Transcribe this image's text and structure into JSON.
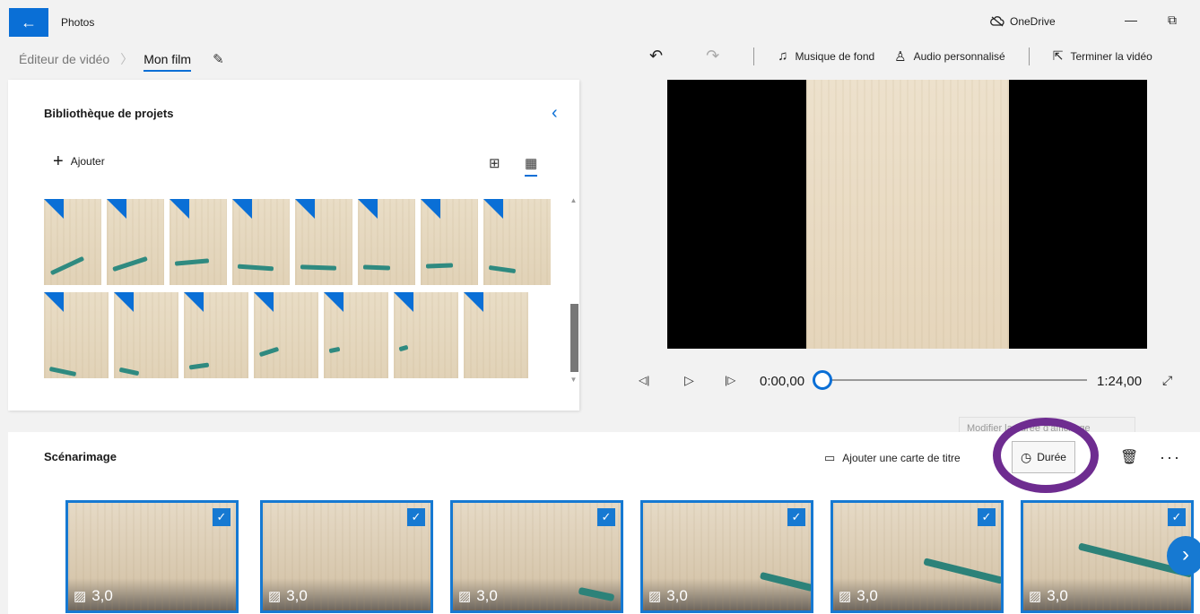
{
  "window": {
    "app_title": "Photos",
    "onedrive_label": "OneDrive",
    "minimize_glyph": "—",
    "restore_glyph": "⧉"
  },
  "breadcrumb": {
    "parent": "Éditeur de vidéo",
    "current": "Mon film"
  },
  "toolbar": {
    "undo_icon": "undo-icon",
    "redo_icon": "redo-icon",
    "background_music": "Musique de fond",
    "custom_audio": "Audio personnalisé",
    "finish_video": "Terminer la vidéo"
  },
  "library": {
    "title": "Bibliothèque de projets",
    "add_label": "Ajouter",
    "thumbnails_count": 15
  },
  "player": {
    "current_time": "0:00,00",
    "total_time": "1:24,00",
    "progress": 0
  },
  "tooltip": {
    "text": "Modifier la durée d'affichage"
  },
  "storyboard": {
    "title": "Scénarimage",
    "add_title_card": "Ajouter une carte de titre",
    "duration_label": "Durée",
    "clips": [
      {
        "duration": "3,0"
      },
      {
        "duration": "3,0"
      },
      {
        "duration": "3,0"
      },
      {
        "duration": "3,0"
      },
      {
        "duration": "3,0"
      },
      {
        "duration": "3,0"
      }
    ]
  },
  "colors": {
    "accent": "#0a6fd6",
    "highlight_ring": "#6e2c90"
  }
}
